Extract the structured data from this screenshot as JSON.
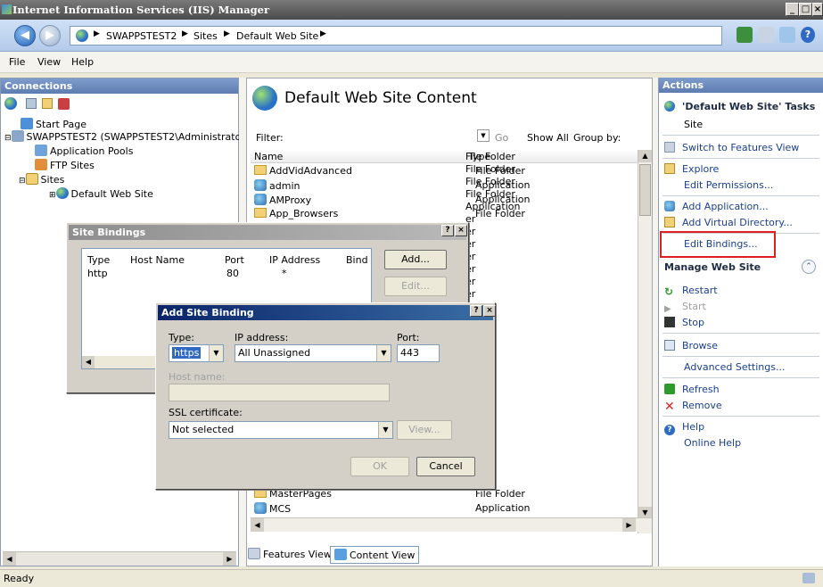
{
  "window": {
    "title": "Internet Information Services (IIS) Manager"
  },
  "address": {
    "crumbs": [
      "SWAPPSTEST2",
      "Sites",
      "Default Web Site"
    ]
  },
  "menu": {
    "items": [
      "File",
      "View",
      "Help"
    ]
  },
  "connections": {
    "header": "Connections",
    "tree": [
      "Start Page",
      "SWAPPSTEST2 (SWAPPSTEST2\\Administrator",
      "Application Pools",
      "FTP Sites",
      "Sites",
      "Default Web Site"
    ]
  },
  "content": {
    "title": "Default Web Site Content",
    "filter_label": "Filter:",
    "go_label": "Go",
    "show_all_label": "Show All",
    "group_by_label": "Group by:",
    "col_name": "Name",
    "col_type": "Type",
    "rows": [
      {
        "name": "AddVidAdvanced",
        "type": "File Folder"
      },
      {
        "name": "admin",
        "type": "Application"
      },
      {
        "name": "AMProxy",
        "type": "Application"
      },
      {
        "name": "App_Browsers",
        "type": "File Folder"
      }
    ],
    "partial_types": [
      "File Folder",
      "File Folder",
      "File Folder",
      "File Folder",
      "Application",
      "er",
      "er",
      "er",
      "er",
      "er",
      "er",
      "er",
      "er",
      "er",
      "er",
      "er",
      "er",
      "er",
      "er",
      "er",
      "er"
    ],
    "bottom_rows": [
      {
        "name": "MasterPages",
        "type": "File Folder"
      },
      {
        "name": "MCS",
        "type": "Application"
      }
    ],
    "features_view": "Features View",
    "content_view": "Content View"
  },
  "site_bindings": {
    "title": "Site Bindings",
    "columns": [
      "Type",
      "Host Name",
      "Port",
      "IP Address",
      "Bind"
    ],
    "row": {
      "type": "http",
      "host": "",
      "port": "80",
      "ip": "*"
    },
    "add_button": "Add...",
    "edit_button": "Edit..."
  },
  "add_binding": {
    "title": "Add Site Binding",
    "type_label": "Type:",
    "type_value": "https",
    "ip_label": "IP address:",
    "ip_value": "All Unassigned",
    "port_label": "Port:",
    "port_value": "443",
    "host_label": "Host name:",
    "host_value": "",
    "ssl_label": "SSL certificate:",
    "ssl_value": "Not selected",
    "view_button": "View...",
    "ok_button": "OK",
    "cancel_button": "Cancel"
  },
  "actions": {
    "header": "Actions",
    "tasks_title": "'Default Web Site' Tasks",
    "site_label": "Site",
    "switch": "Switch to Features View",
    "explore": "Explore",
    "edit_permissions": "Edit Permissions...",
    "add_application": "Add Application...",
    "add_vdir": "Add Virtual Directory...",
    "edit_bindings": "Edit Bindings...",
    "manage_header": "Manage Web Site",
    "restart": "Restart",
    "start": "Start",
    "stop": "Stop",
    "browse": "Browse",
    "advanced": "Advanced Settings...",
    "refresh": "Refresh",
    "remove": "Remove",
    "help": "Help",
    "online_help": "Online Help"
  },
  "status": {
    "text": "Ready"
  },
  "colors": {
    "highlight": "#e02020",
    "dialog_title": "#0a246a"
  }
}
